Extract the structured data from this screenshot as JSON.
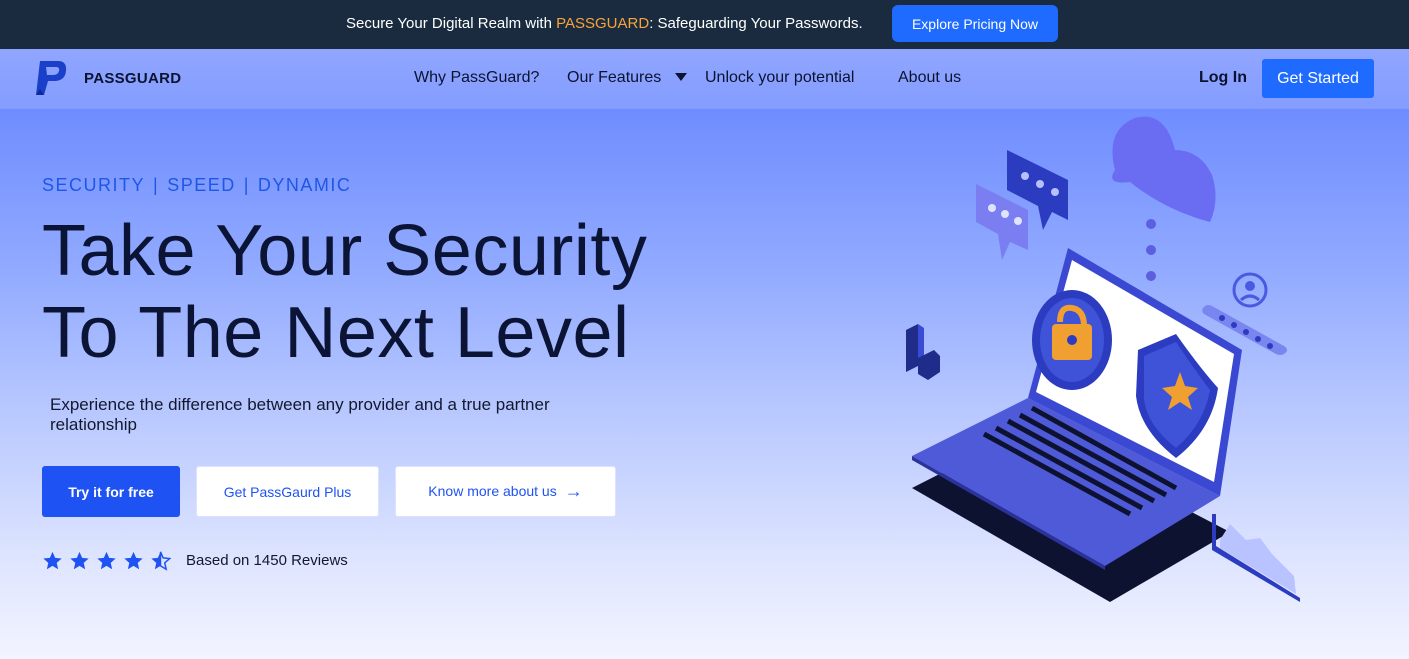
{
  "announcement": {
    "text_before": "Secure Your Digital Realm with ",
    "brand": "PASSGUARD",
    "text_after": ": Safeguarding Your Passwords.",
    "cta": "Explore Pricing Now"
  },
  "nav": {
    "logo_text": "PASSGUARD",
    "items": [
      {
        "label": "Why PassGuard?"
      },
      {
        "label": "Our Features",
        "dropdown": true
      },
      {
        "label": "Unlock your potential"
      },
      {
        "label": "About us"
      }
    ],
    "login": "Log In",
    "get_started": "Get Started"
  },
  "hero": {
    "tagline": [
      "SECURITY",
      "SPEED",
      "DYNAMIC"
    ],
    "tagline_separator": "|",
    "headline_line1": "Take Your Security",
    "headline_line2": "To The Next Level",
    "subtext": "Experience the difference between any provider and a true partner relationship",
    "buttons": {
      "primary": "Try it for free",
      "secondary": "Get PassGaurd Plus",
      "tertiary": "Know more about us"
    },
    "rating": 4.5,
    "rating_max": 5,
    "reviews": "Based on 1450 Reviews"
  },
  "colors": {
    "topbar": "#1a2b3f",
    "accent": "#1f6bff",
    "brand_highlight": "#f7a43a",
    "headline": "#0c1435"
  },
  "icons": [
    "logo-icon",
    "chevron-down-icon",
    "arrow-right-icon",
    "star-icon",
    "star-half-icon",
    "security-laptop-illustration"
  ]
}
